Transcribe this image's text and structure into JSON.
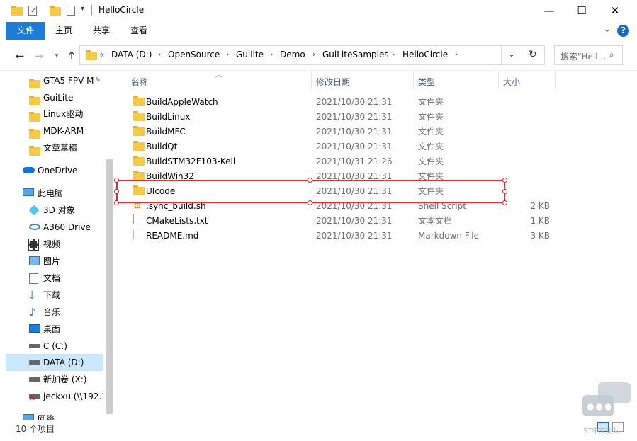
{
  "window": {
    "title": "HelloCircle",
    "minimize_glyph": "—",
    "maximize_glyph": "☐",
    "close_glyph": "✕"
  },
  "ribbon": {
    "tabs": [
      {
        "label": "文件"
      },
      {
        "label": "主页"
      },
      {
        "label": "共享"
      },
      {
        "label": "查看"
      }
    ],
    "help_glyph": "?",
    "collapse_glyph": "⌄"
  },
  "address": {
    "overflow": "«",
    "crumbs": [
      "DATA (D:)",
      "OpenSource",
      "Guilite",
      "Demo",
      "GuiLiteSamples",
      "HelloCircle"
    ],
    "search_placeholder": "搜索\"Hell..."
  },
  "sidebar": {
    "items": [
      {
        "label": "GTA5 FPV M",
        "icon": "folder-icon"
      },
      {
        "label": "GuiLite",
        "icon": "folder-icon"
      },
      {
        "label": "Linux驱动",
        "icon": "folder-icon"
      },
      {
        "label": "MDK-ARM",
        "icon": "folder-icon"
      },
      {
        "label": "文章草稿",
        "icon": "folder-icon"
      },
      {
        "label": "OneDrive",
        "icon": "cloud-icon"
      },
      {
        "label": "此电脑",
        "icon": "computer-icon"
      },
      {
        "label": "3D 对象",
        "icon": "cube-icon"
      },
      {
        "label": "A360 Drive",
        "icon": "eye-icon"
      },
      {
        "label": "视频",
        "icon": "film-icon"
      },
      {
        "label": "图片",
        "icon": "picture-icon"
      },
      {
        "label": "文档",
        "icon": "document-icon"
      },
      {
        "label": "下载",
        "icon": "download-arrow-icon"
      },
      {
        "label": "音乐",
        "icon": "music-note-icon"
      },
      {
        "label": "桌面",
        "icon": "desktop-icon"
      },
      {
        "label": "C (C:)",
        "icon": "drive-icon"
      },
      {
        "label": "DATA (D:)",
        "icon": "drive-icon"
      },
      {
        "label": "新加卷 (X:)",
        "icon": "drive-icon"
      },
      {
        "label": "jeckxu (\\\\192.1",
        "icon": "network-drive-icon"
      },
      {
        "label": "网络",
        "icon": "network-icon"
      }
    ]
  },
  "columns": {
    "name": "名称",
    "date": "修改日期",
    "type": "类型",
    "size": "大小"
  },
  "files": [
    {
      "name": "BuildAppleWatch",
      "date": "2021/10/30 21:31",
      "type": "文件夹",
      "size": "",
      "icon": "folder-icon"
    },
    {
      "name": "BuildLinux",
      "date": "2021/10/30 21:31",
      "type": "文件夹",
      "size": "",
      "icon": "folder-icon"
    },
    {
      "name": "BuildMFC",
      "date": "2021/10/30 21:31",
      "type": "文件夹",
      "size": "",
      "icon": "folder-icon"
    },
    {
      "name": "BuildQt",
      "date": "2021/10/30 21:31",
      "type": "文件夹",
      "size": "",
      "icon": "folder-icon"
    },
    {
      "name": "BuildSTM32F103-Keil",
      "date": "2021/10/31 21:26",
      "type": "文件夹",
      "size": "",
      "icon": "folder-icon"
    },
    {
      "name": "BuildWin32",
      "date": "2021/10/30 21:31",
      "type": "文件夹",
      "size": "",
      "icon": "folder-icon"
    },
    {
      "name": "UIcode",
      "date": "2021/10/30 21:31",
      "type": "文件夹",
      "size": "",
      "icon": "folder-icon"
    },
    {
      "name": ".sync_build.sh",
      "date": "2021/10/30 21:31",
      "type": "Shell Script",
      "size": "2 KB",
      "icon": "script-icon"
    },
    {
      "name": "CMakeLists.txt",
      "date": "2021/10/30 21:31",
      "type": "文本文档",
      "size": "1 KB",
      "icon": "text-file-icon"
    },
    {
      "name": "README.md",
      "date": "2021/10/30 21:31",
      "type": "Markdown File",
      "size": "3 KB",
      "icon": "markdown-file-icon"
    }
  ],
  "status": {
    "count": "10 个项目"
  },
  "watermark": {
    "text": "ST中文论坛"
  },
  "colors": {
    "file_tab": "#1e7bd6",
    "highlight_border": "#e03030",
    "folder": "#f7c948",
    "selected_nav": "#cce8ff"
  }
}
